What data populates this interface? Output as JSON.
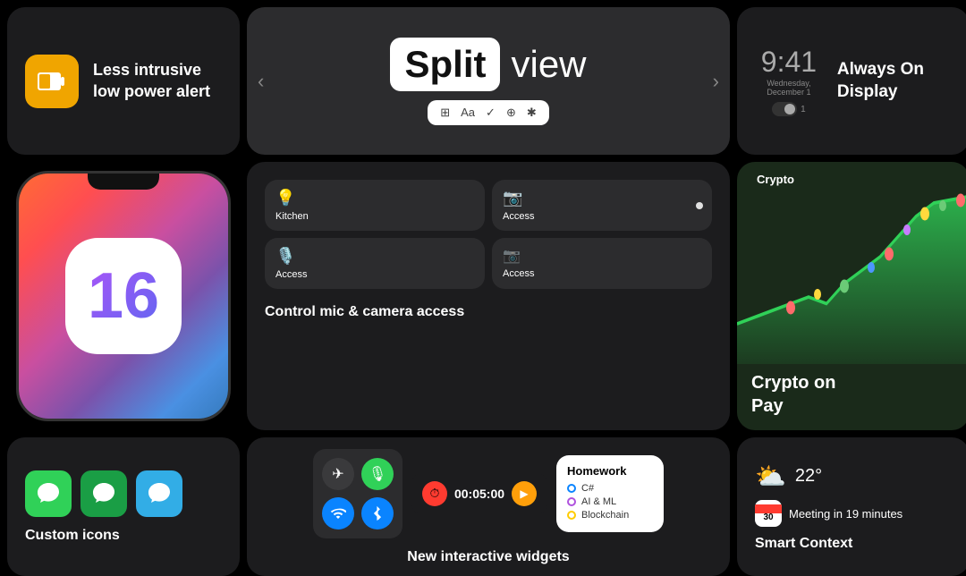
{
  "cards": {
    "low_power": {
      "title": "Less intrusive low power alert",
      "icon_color": "#f0a500"
    },
    "split_view": {
      "word1": "Split",
      "word2": "view",
      "toolbar_items": [
        "⊞",
        "Aa",
        "✓",
        "⊕",
        "✱"
      ]
    },
    "always_on": {
      "time": "9:41",
      "date": "Wednesday, December 1",
      "label": "Always On Display"
    },
    "control": {
      "items": [
        {
          "icon": "💡",
          "label": "Kitchen"
        },
        {
          "icon": "📷",
          "label": "Access"
        },
        {
          "icon": "🎙️",
          "label": "Access"
        },
        {
          "icon": "📷",
          "label": "Access"
        }
      ],
      "caption": "Control mic & camera access"
    },
    "phone": {
      "number": "16"
    },
    "crypto": {
      "header": "Crypto",
      "label": "Crypto on",
      "label2": " Pay"
    },
    "custom_icons": {
      "caption": "Custom icons"
    },
    "widgets": {
      "caption": "New interactive widgets",
      "timer_value": "00:05:00",
      "homework": {
        "title": "Homework",
        "items": [
          "C#",
          "AI & ML",
          "Blockchain"
        ]
      }
    },
    "smart_context": {
      "temperature": "22°",
      "meeting_day": "30",
      "meeting_text": "Meeting in 19 minutes",
      "caption": "Smart Context"
    }
  }
}
